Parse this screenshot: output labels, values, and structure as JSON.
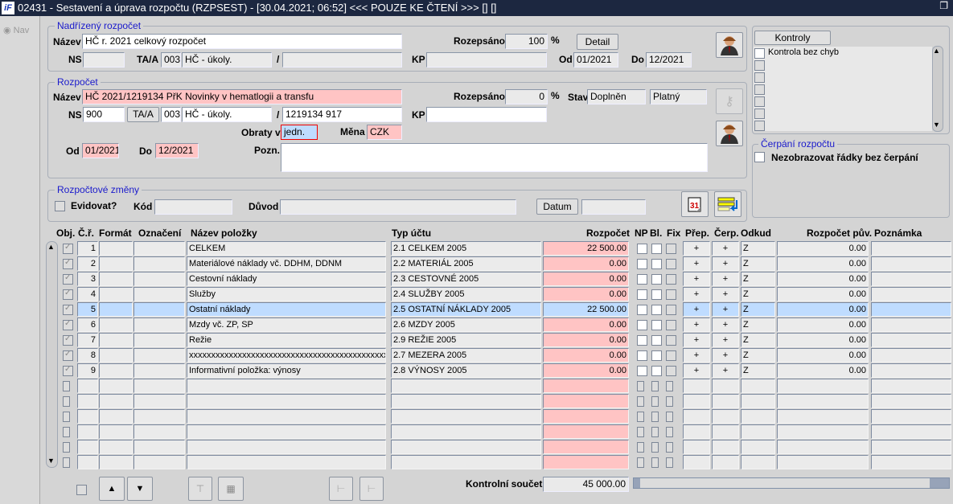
{
  "title": "02431 - Sestavení a úprava rozpočtu (RZPSEST) - [30.04.2021; 06:52] <<< POUZE KE ČTENÍ >>>  [] []",
  "logo": "iF",
  "nav": "Nav",
  "parent": {
    "group": "Nadřízený rozpočet",
    "name_label": "Název",
    "name": "HČ r. 2021 celkový rozpočet",
    "rozepsano_label": "Rozepsáno",
    "rozepsano": "100",
    "pct": "%",
    "detail": "Detail",
    "ns_label": "NS",
    "ns": "",
    "taa_label": "TA/A",
    "taa_code": "003",
    "taa_name": "HČ - úkoly.",
    "slash": "/",
    "slash_val": "",
    "kp_label": "KP",
    "kp": "",
    "od_label": "Od",
    "od": "01/2021",
    "do_label": "Do",
    "do": "12/2021"
  },
  "budget": {
    "group": "Rozpočet",
    "name_label": "Název",
    "name": "HČ 2021/1219134 PřK Novinky v hematlogii a transfu",
    "rozepsano_label": "Rozepsáno",
    "rozepsano": "0",
    "pct": "%",
    "stav_label": "Stav",
    "stav1": "Doplněn",
    "stav2": "Platný",
    "ns_label": "NS",
    "ns": "900",
    "taa_button": "TA/A",
    "taa_code": "003",
    "taa_name": "HČ - úkoly.",
    "slash": "/",
    "slash_val": "1219134 917",
    "kp_label": "KP",
    "kp": "",
    "obraty_label": "Obraty v",
    "obraty": "jedn.",
    "mena_label": "Měna",
    "mena": "CZK",
    "od_label": "Od",
    "od": "01/2021",
    "do_label": "Do",
    "do": "12/2021",
    "pozn_label": "Pozn.",
    "pozn": ""
  },
  "changes": {
    "group": "Rozpočtové změny",
    "evidovat": "Evidovat?",
    "kod_label": "Kód",
    "kod": "",
    "duvod_label": "Důvod",
    "duvod": "",
    "datum": "Datum",
    "datum_val": ""
  },
  "controls": {
    "button": "Kontroly",
    "items": [
      "Kontrola bez chyb",
      "",
      "",
      "",
      "",
      "",
      ""
    ]
  },
  "cerpani": {
    "group": "Čerpání rozpočtu",
    "option": "Nezobrazovat řádky bez čerpání"
  },
  "table": {
    "headers": [
      "Obj.",
      "Č.ř.",
      "Formát",
      "Označení",
      "Název položky",
      "Typ účtu",
      "Rozpočet",
      "NP",
      "Bl.",
      "Fix",
      "Přep.",
      "Čerp.",
      "Odkud",
      "Rozpočet pův.",
      "Poznámka"
    ],
    "rows": [
      {
        "n": "1",
        "name": "CELKEM",
        "typ": "2.1 CELKEM 2005",
        "rozp": "22 500.00",
        "prep": "+",
        "cerp": "+",
        "odkud": "Z",
        "puv": "0.00"
      },
      {
        "n": "2",
        "name": "Materiálové náklady vč. DDHM, DDNM",
        "typ": "2.2 MATERIÁL 2005",
        "rozp": "0.00",
        "prep": "+",
        "cerp": "+",
        "odkud": "Z",
        "puv": "0.00"
      },
      {
        "n": "3",
        "name": "Cestovní náklady",
        "typ": "2.3 CESTOVNÉ 2005",
        "rozp": "0.00",
        "prep": "+",
        "cerp": "+",
        "odkud": "Z",
        "puv": "0.00"
      },
      {
        "n": "4",
        "name": "Služby",
        "typ": "2.4 SLUŽBY 2005",
        "rozp": "0.00",
        "prep": "+",
        "cerp": "+",
        "odkud": "Z",
        "puv": "0.00"
      },
      {
        "n": "5",
        "name": "Ostatní náklady",
        "typ": "2.5 OSTATNÍ NÁKLADY 2005",
        "rozp": "22 500.00",
        "prep": "+",
        "cerp": "+",
        "odkud": "Z",
        "puv": "0.00",
        "selected": true
      },
      {
        "n": "6",
        "name": "Mzdy vč. ZP, SP",
        "typ": "2.6 MZDY 2005",
        "rozp": "0.00",
        "prep": "+",
        "cerp": "+",
        "odkud": "Z",
        "puv": "0.00"
      },
      {
        "n": "7",
        "name": "Režie",
        "typ": "2.9 REŽIE 2005",
        "rozp": "0.00",
        "prep": "+",
        "cerp": "+",
        "odkud": "Z",
        "puv": "0.00"
      },
      {
        "n": "8",
        "name": "xxxxxxxxxxxxxxxxxxxxxxxxxxxxxxxxxxxxxxxxxxxxxxxxx",
        "typ": "2.7 MEZERA 2005",
        "rozp": "0.00",
        "prep": "+",
        "cerp": "+",
        "odkud": "Z",
        "puv": "0.00"
      },
      {
        "n": "9",
        "name": "Informativní položka: výnosy",
        "typ": "2.8 VÝNOSY 2005",
        "rozp": "0.00",
        "prep": "+",
        "cerp": "+",
        "odkud": "Z",
        "puv": "0.00"
      }
    ],
    "empty_rows": 6
  },
  "footer": {
    "checksum_label": "Kontrolní součet",
    "checksum": "45 000.00"
  },
  "colors": {
    "titlebar": "#1c2740",
    "pink": "#ffc4c4",
    "selected": "#bfdcff",
    "group_title": "#1a1acc"
  }
}
